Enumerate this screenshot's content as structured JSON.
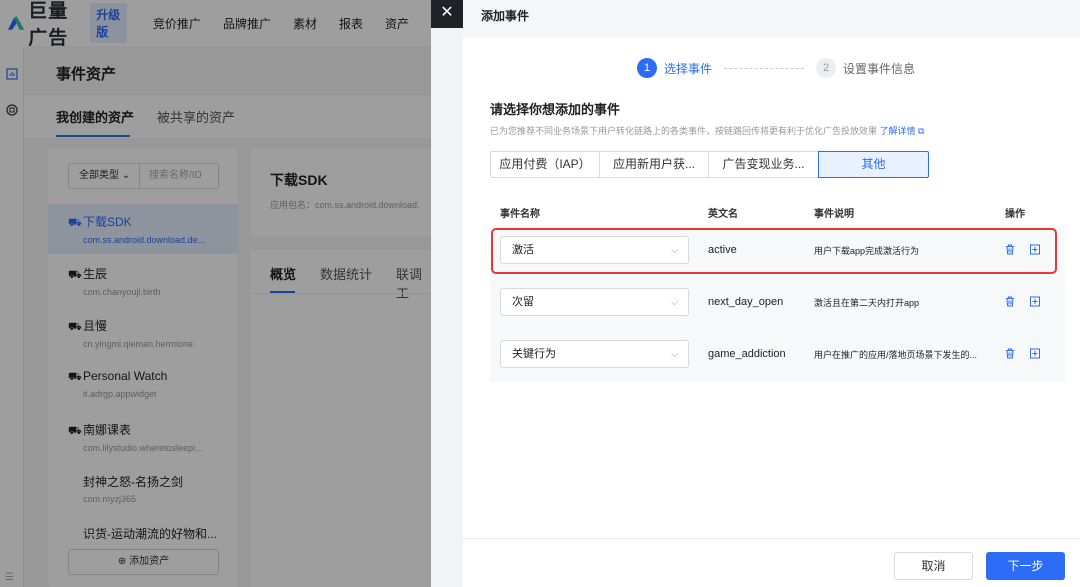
{
  "app": {
    "logo_text": "巨量广告",
    "upgrade_badge": "升级版",
    "top_nav": [
      "竞价推广",
      "品牌推广",
      "素材",
      "报表",
      "资产"
    ]
  },
  "background": {
    "page_title": "事件资产",
    "tabs": [
      "我创建的资产",
      "被共享的资产"
    ],
    "filter": {
      "type_label": "全部类型",
      "search_placeholder": "搜索名称/ID"
    },
    "assets": [
      {
        "name": "下载SDK",
        "pkg": "com.ss.android.download.de...",
        "icon": "android-icon",
        "selected": true
      },
      {
        "name": "生辰",
        "pkg": "com.chanyouji.birth",
        "icon": "android-icon"
      },
      {
        "name": "且慢",
        "pkg": "cn.yingmi.qieman.hermione",
        "icon": "android-icon"
      },
      {
        "name": "Personal Watch",
        "pkg": "it.adrgp.appwidget",
        "icon": "android-icon"
      },
      {
        "name": "南娜课表",
        "pkg": "com.lilystudio.wheretosleepi...",
        "icon": "android-icon"
      },
      {
        "name": "封神之怒-名扬之剑",
        "pkg": "com.myzj365",
        "icon": "apple-icon"
      },
      {
        "name": "识货-运动潮流的好物和...",
        "pkg": "",
        "icon": "apple-icon"
      }
    ],
    "add_asset_label": "添加资产",
    "detail": {
      "title": "下载SDK",
      "pkg": "应用包名：com.ss.android.download.",
      "tabs": [
        "概览",
        "数据统计",
        "联调工"
      ]
    }
  },
  "drawer": {
    "close_glyph": "✕",
    "title": "添加事件",
    "steps": [
      {
        "num": "1",
        "label": "选择事件",
        "active": true
      },
      {
        "num": "2",
        "label": "设置事件信息",
        "active": false
      }
    ],
    "section_title": "请选择你想添加的事件",
    "section_desc": "已为您推荐不同业务场景下用户转化链路上的各类事件，按链路回传将更有利于优化广告投放效果 ",
    "learn_more": "了解详情",
    "category_tabs": [
      "应用付费（IAP）",
      "应用新用户获...",
      "广告变现业务...",
      "其他"
    ],
    "active_category": 3,
    "table": {
      "headers": [
        "事件名称",
        "英文名",
        "事件说明",
        "操作"
      ],
      "rows": [
        {
          "name": "激活",
          "en": "active",
          "desc": "用户下载app完成激活行为",
          "highlighted": true
        },
        {
          "name": "次留",
          "en": "next_day_open",
          "desc": "激活且在第二天内打开app"
        },
        {
          "name": "关键行为",
          "en": "game_addiction",
          "desc": "用户在推广的应用/落地页场景下发生的..."
        }
      ]
    },
    "footer": {
      "cancel": "取消",
      "next": "下一步"
    }
  },
  "colors": {
    "primary": "#2c6cf6",
    "highlight": "#e53935",
    "overlay": "rgba(0,0,0,0.38)"
  }
}
